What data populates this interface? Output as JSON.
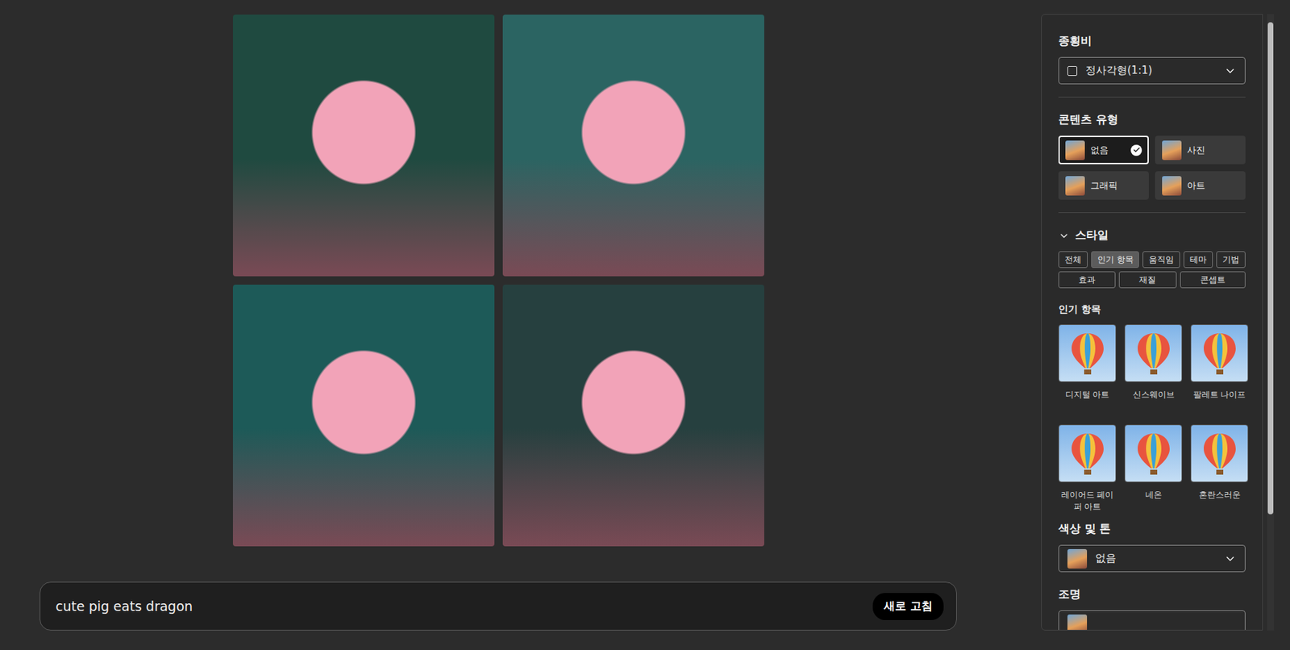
{
  "images": [
    {
      "color": "#1f4a40"
    },
    {
      "color": "#2b6462"
    },
    {
      "color": "#1d5a58"
    },
    {
      "color": "#26403f"
    }
  ],
  "prompt": {
    "value": "cute pig eats dragon",
    "button": "새로 고침"
  },
  "panel": {
    "aspect_ratio": {
      "label": "종횡비",
      "value": "정사각형(1:1)"
    },
    "content_type": {
      "label": "콘텐츠 유형",
      "options": [
        {
          "label": "없음",
          "selected": true
        },
        {
          "label": "사진",
          "selected": false
        },
        {
          "label": "그래픽",
          "selected": false
        },
        {
          "label": "아트",
          "selected": false
        }
      ]
    },
    "style": {
      "label": "스타일",
      "expanded": true,
      "tabs": [
        {
          "label": "전체",
          "selected": false
        },
        {
          "label": "인기 항목",
          "selected": true
        },
        {
          "label": "움직임",
          "selected": false
        },
        {
          "label": "테마",
          "selected": false
        },
        {
          "label": "기법",
          "selected": false
        },
        {
          "label": "효과",
          "selected": false
        },
        {
          "label": "재질",
          "selected": false
        },
        {
          "label": "콘셉트",
          "selected": false
        }
      ],
      "section": "인기 항목",
      "items": [
        {
          "label": "디지털 아트"
        },
        {
          "label": "신스웨이브"
        },
        {
          "label": "팔레트 나이프"
        },
        {
          "label": "레이어드 페이퍼 아트"
        },
        {
          "label": "네온"
        },
        {
          "label": "혼란스러운"
        }
      ]
    },
    "color_tone": {
      "label": "색상 및 톤",
      "value": "없음"
    },
    "lighting": {
      "label": "조명"
    }
  },
  "scrollbar": {
    "level": 0.82
  }
}
